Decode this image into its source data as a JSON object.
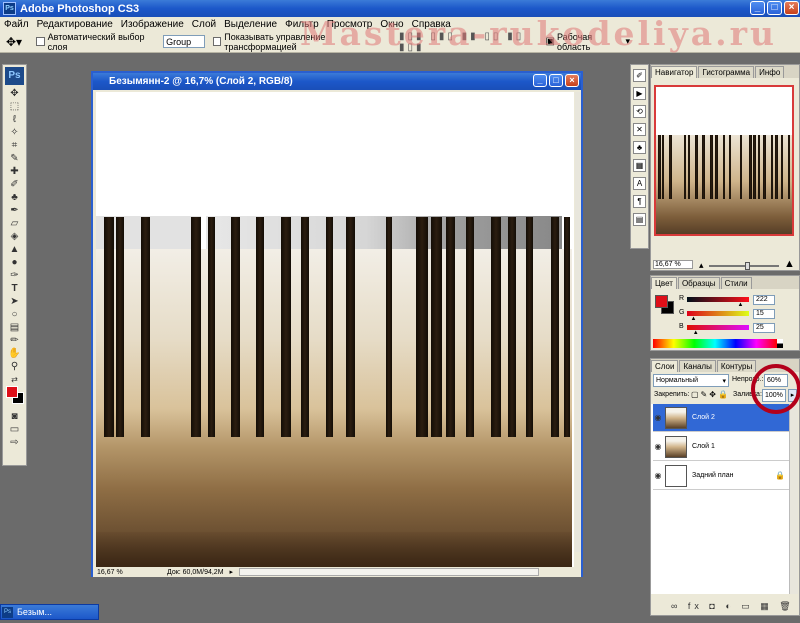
{
  "app": {
    "title": "Adobe Photoshop CS3",
    "icon": "Ps"
  },
  "watermark": "Mastera-rukodeliya.ru",
  "menu": [
    "Файл",
    "Редактирование",
    "Изображение",
    "Слой",
    "Выделение",
    "Фильтр",
    "Просмотр",
    "Окно",
    "Справка"
  ],
  "options": {
    "auto_select_label": "Автоматический выбор слоя",
    "group_value": "Group",
    "show_transform_label": "Показывать управление трансформацией",
    "workspace_label": "Рабочая область"
  },
  "toolbox": {
    "logo": "Ps"
  },
  "document": {
    "title": "Безымянн-2 @ 16,7% (Слой 2, RGB/8)",
    "zoom": "16,67 %",
    "doc_size": "Док: 60,0M/94,2M"
  },
  "navigator": {
    "tabs": [
      "Навигатор",
      "Гистограмма",
      "Инфо"
    ],
    "zoom": "16,67 %",
    "zoom_fraction": 0.55
  },
  "color": {
    "tabs": [
      "Цвет",
      "Образцы",
      "Стили"
    ],
    "channels": [
      {
        "name": "R",
        "value": "222",
        "fraction": 0.87
      },
      {
        "name": "G",
        "value": "15",
        "fraction": 0.06
      },
      {
        "name": "B",
        "value": "25",
        "fraction": 0.1
      }
    ],
    "foreground": "#de0f19",
    "background": "#000000"
  },
  "layers": {
    "tabs": [
      "Слои",
      "Каналы",
      "Контуры"
    ],
    "blend_mode": "Нормальный",
    "opacity_label": "Непрозр.:",
    "opacity_value": "60%",
    "lock_label": "Закрепить:",
    "fill_label": "Заливка:",
    "fill_value": "100%",
    "items": [
      {
        "name": "Слой 2",
        "selected": true
      },
      {
        "name": "Слой 1",
        "selected": false
      },
      {
        "name": "Задний план",
        "selected": false
      }
    ],
    "highlight_color": "#3168d5",
    "annotation_color": "#b3001b"
  },
  "taskbar": {
    "minimized_label": "Безым..."
  }
}
